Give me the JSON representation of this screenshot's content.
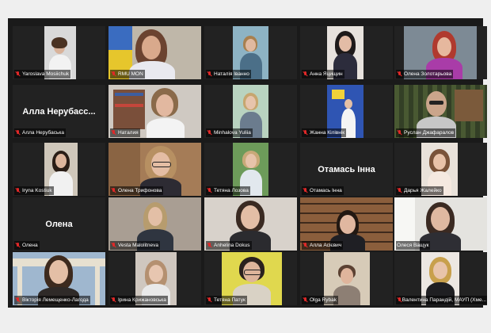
{
  "grid": {
    "rows": [
      [
        {
          "label": "Yaroslava Mosiichuk",
          "type": "video",
          "muted": true
        },
        {
          "label": "RMU MON",
          "type": "video",
          "muted": true
        },
        {
          "label": "Наталія Іванно",
          "type": "video",
          "muted": true
        },
        {
          "label": "Анна Яцищин",
          "type": "video",
          "muted": true
        },
        {
          "label": "Олена Золотарьова",
          "type": "video",
          "muted": true
        }
      ],
      [
        {
          "label": "Алла Нерубаська",
          "type": "name",
          "display_name": "Алла  Нерубасс...",
          "muted": true
        },
        {
          "label": "Наталия",
          "type": "video",
          "muted": true
        },
        {
          "label": "Minhalova Yuliia",
          "type": "video",
          "muted": true
        },
        {
          "label": "Жанна Кілівнік",
          "type": "video",
          "muted": true
        },
        {
          "label": "Руслан Джафаралов",
          "type": "video",
          "muted": true
        }
      ],
      [
        {
          "label": "Iryna Kostiuk",
          "type": "video",
          "muted": true
        },
        {
          "label": "Олена Трифонова",
          "type": "video",
          "muted": true
        },
        {
          "label": "Тетяна Лозова",
          "type": "video",
          "muted": true
        },
        {
          "label": "Отамась Інна",
          "type": "name",
          "display_name": "Отамась Інна",
          "muted": true
        },
        {
          "label": "Дарья Жалейко",
          "type": "video",
          "muted": true
        }
      ],
      [
        {
          "label": "Олена",
          "type": "name",
          "display_name": "Олена",
          "muted": true
        },
        {
          "label": "Vesta Malolitneva",
          "type": "video",
          "muted": true
        },
        {
          "label": "Anhelina Dokus",
          "type": "video",
          "muted": true
        },
        {
          "label": "Алла Асієвич",
          "type": "video",
          "muted": true
        },
        {
          "label": "Олеся Ващук",
          "type": "video",
          "muted": false,
          "active_speaker": true
        }
      ],
      [
        {
          "label": "Вікторія Лемещенко-Лагода",
          "type": "video",
          "muted": true
        },
        {
          "label": "Ірина Крижановська",
          "type": "video",
          "muted": true
        },
        {
          "label": "Тетяна Патук",
          "type": "video",
          "muted": true
        },
        {
          "label": "Olga Rybak",
          "type": "video",
          "muted": true
        },
        {
          "label": "Валентина Парандій, МАУП (Хме...",
          "type": "video",
          "muted": true
        }
      ]
    ]
  },
  "colors": {
    "background": "#1a1a1a",
    "tile": "#222222",
    "mic_muted": "#e02828",
    "active_border": "#b7dc5c"
  }
}
